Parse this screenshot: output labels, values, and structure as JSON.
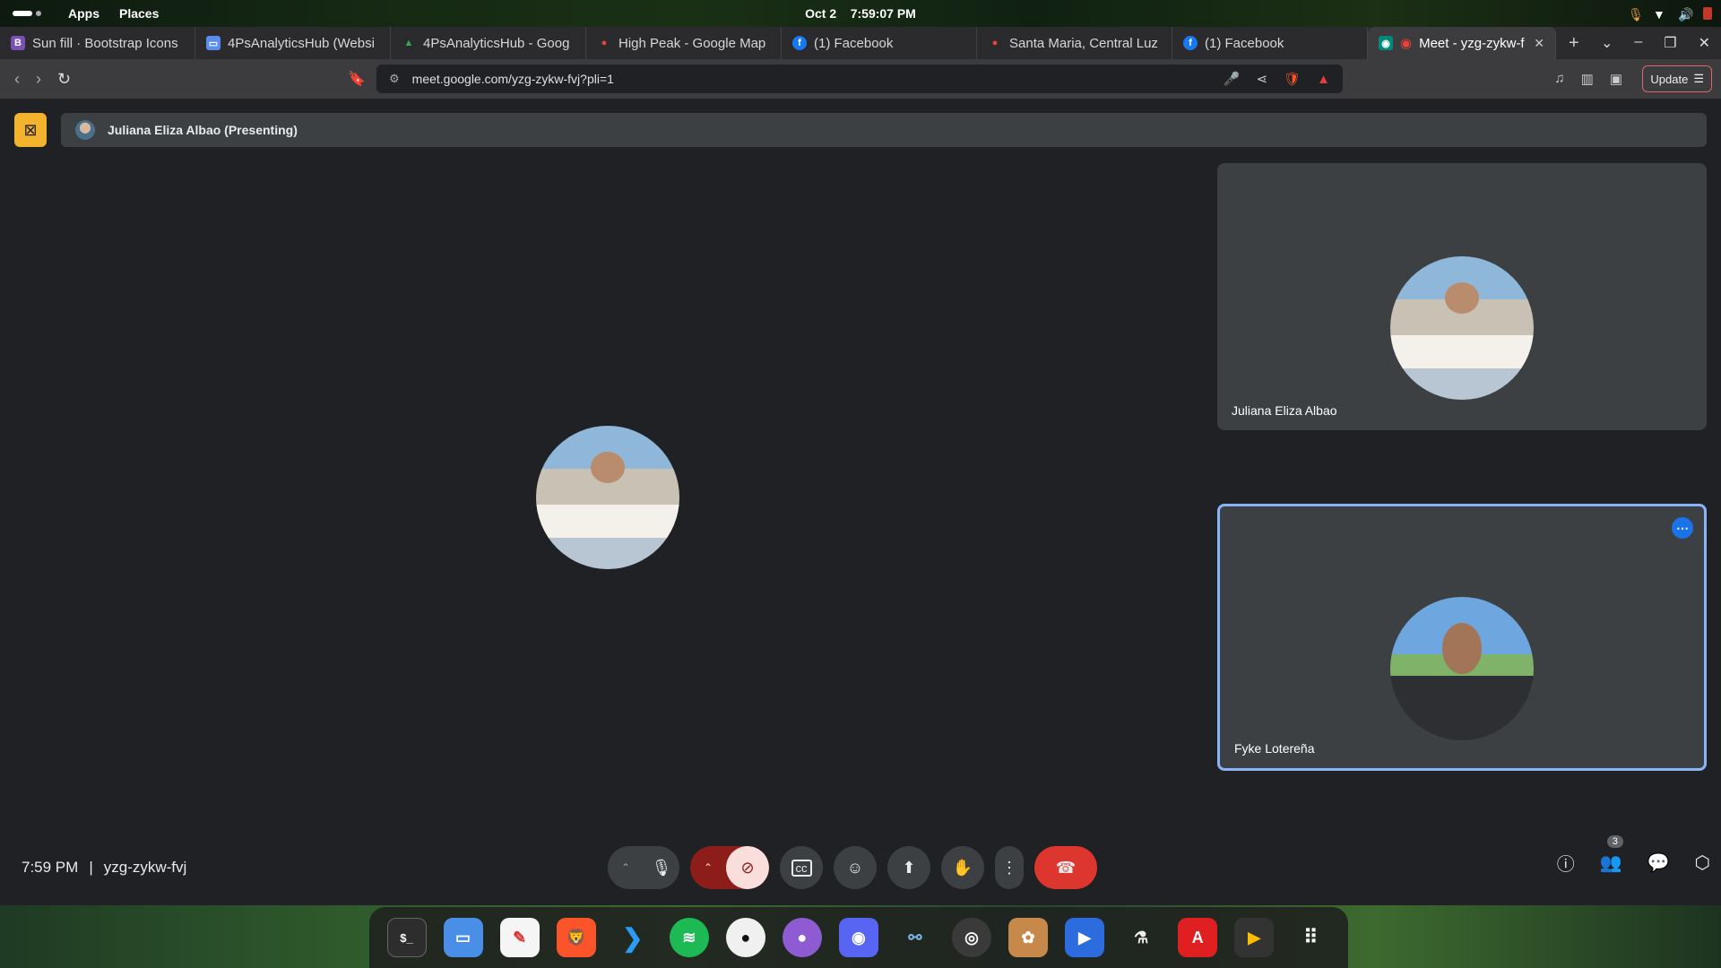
{
  "topbar": {
    "apps_label": "Apps",
    "places_label": "Places",
    "date": "Oct 2",
    "time": "7:59:07 PM"
  },
  "tabs": [
    {
      "label": "Sun fill · Bootstrap Icons",
      "icon": "bootstrap-icon",
      "color": "#7952b3",
      "glyph": "B"
    },
    {
      "label": "4PsAnalyticsHub (Websi",
      "icon": "window-icon",
      "color": "#5b8def",
      "glyph": "▭"
    },
    {
      "label": "4PsAnalyticsHub - Goog",
      "icon": "drive-icon",
      "color": "#34a853",
      "glyph": "▲"
    },
    {
      "label": "High Peak - Google Map",
      "icon": "maps-pin-icon",
      "color": "#ea4335",
      "glyph": "●"
    },
    {
      "label": "(1) Facebook",
      "icon": "facebook-icon",
      "color": "#1877f2",
      "glyph": "f"
    },
    {
      "label": "Santa Maria, Central Luz",
      "icon": "maps-pin-icon",
      "color": "#ea4335",
      "glyph": "●"
    },
    {
      "label": "(1) Facebook",
      "icon": "facebook-icon",
      "color": "#1877f2",
      "glyph": "f"
    },
    {
      "label": "Meet - yzg-zykw-f",
      "icon": "meet-icon",
      "color": "#00897b",
      "glyph": "◉",
      "active": true
    }
  ],
  "address_bar": {
    "url": "meet.google.com/yzg-zykw-fvj?pli=1"
  },
  "toolbar": {
    "update_label": "Update"
  },
  "meet": {
    "presenting_label": "Juliana Eliza Albao (Presenting)",
    "participants": [
      {
        "name": "Juliana Eliza Albao"
      },
      {
        "name": "Fyke Lotereña"
      }
    ],
    "clock": "7:59 PM",
    "separator": "|",
    "meeting_code": "yzg-zykw-fvj",
    "people_count": "3"
  },
  "colors": {
    "accent": "#8ab4f8",
    "end_call": "#dc362e",
    "present_banner": "#f3b32d",
    "camera_off_bg": "#8c1d18"
  }
}
